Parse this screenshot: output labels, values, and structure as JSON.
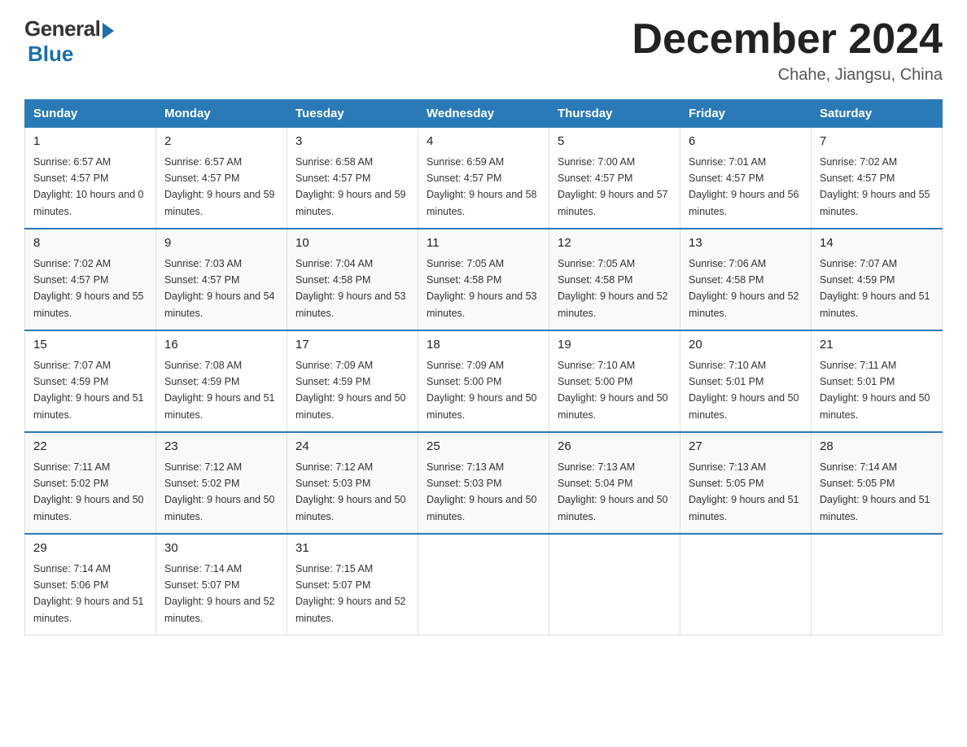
{
  "logo": {
    "general": "General",
    "blue": "Blue"
  },
  "title": "December 2024",
  "subtitle": "Chahe, Jiangsu, China",
  "days_header": [
    "Sunday",
    "Monday",
    "Tuesday",
    "Wednesday",
    "Thursday",
    "Friday",
    "Saturday"
  ],
  "weeks": [
    [
      {
        "num": "1",
        "sunrise": "6:57 AM",
        "sunset": "4:57 PM",
        "daylight": "10 hours and 0 minutes."
      },
      {
        "num": "2",
        "sunrise": "6:57 AM",
        "sunset": "4:57 PM",
        "daylight": "9 hours and 59 minutes."
      },
      {
        "num": "3",
        "sunrise": "6:58 AM",
        "sunset": "4:57 PM",
        "daylight": "9 hours and 59 minutes."
      },
      {
        "num": "4",
        "sunrise": "6:59 AM",
        "sunset": "4:57 PM",
        "daylight": "9 hours and 58 minutes."
      },
      {
        "num": "5",
        "sunrise": "7:00 AM",
        "sunset": "4:57 PM",
        "daylight": "9 hours and 57 minutes."
      },
      {
        "num": "6",
        "sunrise": "7:01 AM",
        "sunset": "4:57 PM",
        "daylight": "9 hours and 56 minutes."
      },
      {
        "num": "7",
        "sunrise": "7:02 AM",
        "sunset": "4:57 PM",
        "daylight": "9 hours and 55 minutes."
      }
    ],
    [
      {
        "num": "8",
        "sunrise": "7:02 AM",
        "sunset": "4:57 PM",
        "daylight": "9 hours and 55 minutes."
      },
      {
        "num": "9",
        "sunrise": "7:03 AM",
        "sunset": "4:57 PM",
        "daylight": "9 hours and 54 minutes."
      },
      {
        "num": "10",
        "sunrise": "7:04 AM",
        "sunset": "4:58 PM",
        "daylight": "9 hours and 53 minutes."
      },
      {
        "num": "11",
        "sunrise": "7:05 AM",
        "sunset": "4:58 PM",
        "daylight": "9 hours and 53 minutes."
      },
      {
        "num": "12",
        "sunrise": "7:05 AM",
        "sunset": "4:58 PM",
        "daylight": "9 hours and 52 minutes."
      },
      {
        "num": "13",
        "sunrise": "7:06 AM",
        "sunset": "4:58 PM",
        "daylight": "9 hours and 52 minutes."
      },
      {
        "num": "14",
        "sunrise": "7:07 AM",
        "sunset": "4:59 PM",
        "daylight": "9 hours and 51 minutes."
      }
    ],
    [
      {
        "num": "15",
        "sunrise": "7:07 AM",
        "sunset": "4:59 PM",
        "daylight": "9 hours and 51 minutes."
      },
      {
        "num": "16",
        "sunrise": "7:08 AM",
        "sunset": "4:59 PM",
        "daylight": "9 hours and 51 minutes."
      },
      {
        "num": "17",
        "sunrise": "7:09 AM",
        "sunset": "4:59 PM",
        "daylight": "9 hours and 50 minutes."
      },
      {
        "num": "18",
        "sunrise": "7:09 AM",
        "sunset": "5:00 PM",
        "daylight": "9 hours and 50 minutes."
      },
      {
        "num": "19",
        "sunrise": "7:10 AM",
        "sunset": "5:00 PM",
        "daylight": "9 hours and 50 minutes."
      },
      {
        "num": "20",
        "sunrise": "7:10 AM",
        "sunset": "5:01 PM",
        "daylight": "9 hours and 50 minutes."
      },
      {
        "num": "21",
        "sunrise": "7:11 AM",
        "sunset": "5:01 PM",
        "daylight": "9 hours and 50 minutes."
      }
    ],
    [
      {
        "num": "22",
        "sunrise": "7:11 AM",
        "sunset": "5:02 PM",
        "daylight": "9 hours and 50 minutes."
      },
      {
        "num": "23",
        "sunrise": "7:12 AM",
        "sunset": "5:02 PM",
        "daylight": "9 hours and 50 minutes."
      },
      {
        "num": "24",
        "sunrise": "7:12 AM",
        "sunset": "5:03 PM",
        "daylight": "9 hours and 50 minutes."
      },
      {
        "num": "25",
        "sunrise": "7:13 AM",
        "sunset": "5:03 PM",
        "daylight": "9 hours and 50 minutes."
      },
      {
        "num": "26",
        "sunrise": "7:13 AM",
        "sunset": "5:04 PM",
        "daylight": "9 hours and 50 minutes."
      },
      {
        "num": "27",
        "sunrise": "7:13 AM",
        "sunset": "5:05 PM",
        "daylight": "9 hours and 51 minutes."
      },
      {
        "num": "28",
        "sunrise": "7:14 AM",
        "sunset": "5:05 PM",
        "daylight": "9 hours and 51 minutes."
      }
    ],
    [
      {
        "num": "29",
        "sunrise": "7:14 AM",
        "sunset": "5:06 PM",
        "daylight": "9 hours and 51 minutes."
      },
      {
        "num": "30",
        "sunrise": "7:14 AM",
        "sunset": "5:07 PM",
        "daylight": "9 hours and 52 minutes."
      },
      {
        "num": "31",
        "sunrise": "7:15 AM",
        "sunset": "5:07 PM",
        "daylight": "9 hours and 52 minutes."
      },
      null,
      null,
      null,
      null
    ]
  ]
}
